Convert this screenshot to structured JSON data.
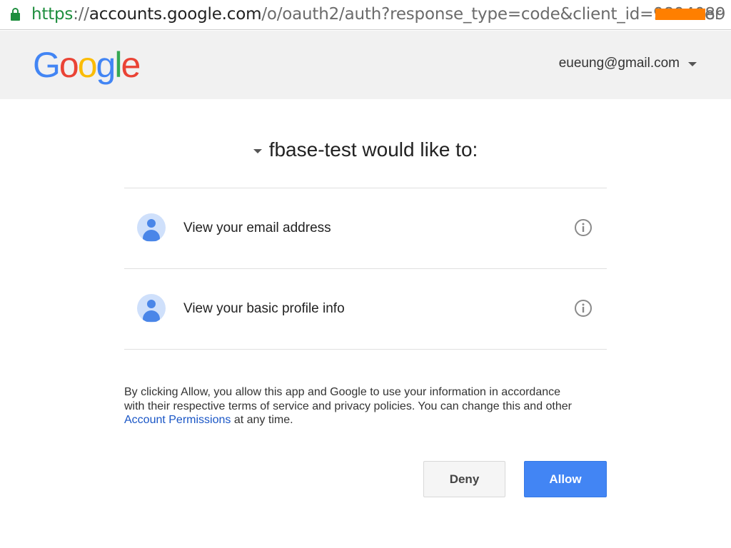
{
  "browser": {
    "url_scheme": "https",
    "url_sep": "://",
    "url_host": "accounts.google.com",
    "url_path": "/o/oauth2/auth?response_type=code&client_id=9894089",
    "url_tail": "er",
    "lock_icon": "lock-icon",
    "secure_color": "#1e8e3e"
  },
  "header": {
    "logo_letters": [
      "G",
      "o",
      "o",
      "g",
      "l",
      "e"
    ],
    "logo_colors": [
      "#4285f4",
      "#ea4335",
      "#fbbc05",
      "#4285f4",
      "#34a853",
      "#ea4335"
    ],
    "account_email": "eueung@gmail.com",
    "account_icon": "chevron-down-icon"
  },
  "main": {
    "title": "fbase-test would like to:",
    "scopes": [
      {
        "label": "View your email address",
        "icon": "person-icon",
        "info_icon": "info-icon"
      },
      {
        "label": "View your basic profile info",
        "icon": "person-icon",
        "info_icon": "info-icon"
      }
    ],
    "consent_before": "By clicking Allow, you allow this app and Google to use your information in accordance with their respective terms of service and privacy policies. You can change this and other ",
    "consent_link": "Account Permissions",
    "consent_after": " at any time.",
    "link_color": "#1a56c6"
  },
  "actions": {
    "deny_label": "Deny",
    "allow_label": "Allow",
    "allow_color": "#4285f4"
  }
}
